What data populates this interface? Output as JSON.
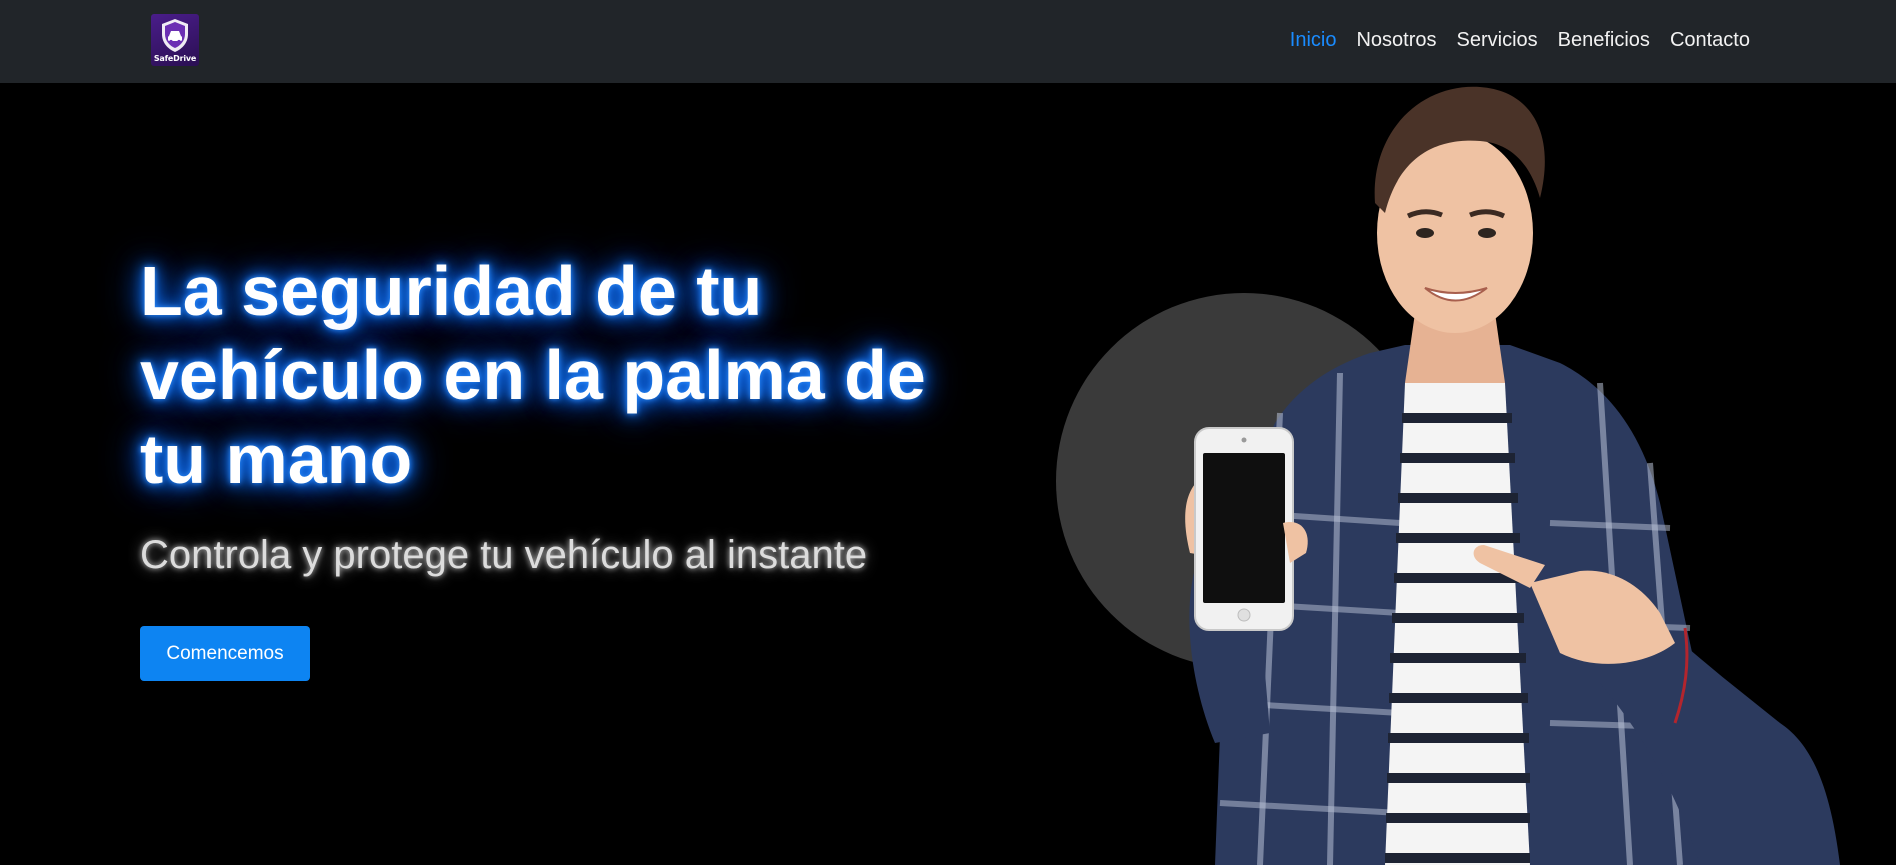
{
  "brand": {
    "logo_text": "SafeDrive",
    "logo_icon": "shield-car-icon"
  },
  "nav": {
    "items": [
      {
        "label": "Inicio",
        "active": true
      },
      {
        "label": "Nosotros",
        "active": false
      },
      {
        "label": "Servicios",
        "active": false
      },
      {
        "label": "Beneficios",
        "active": false
      },
      {
        "label": "Contacto",
        "active": false
      }
    ]
  },
  "hero": {
    "headline": "La seguridad de tu vehículo en la palma de tu mano",
    "subheadline": "Controla y protege tu vehículo al instante",
    "cta_label": "Comencemos",
    "image_subject": "man-holding-smartphone"
  },
  "colors": {
    "navbar_bg": "#212529",
    "hero_bg": "#000000",
    "accent_blue": "#0d84f2",
    "active_nav": "#1a8cff",
    "headline_glow": "#1a7cff",
    "circle": "#3a3a3a",
    "logo_bg": "#4a1d8a"
  }
}
